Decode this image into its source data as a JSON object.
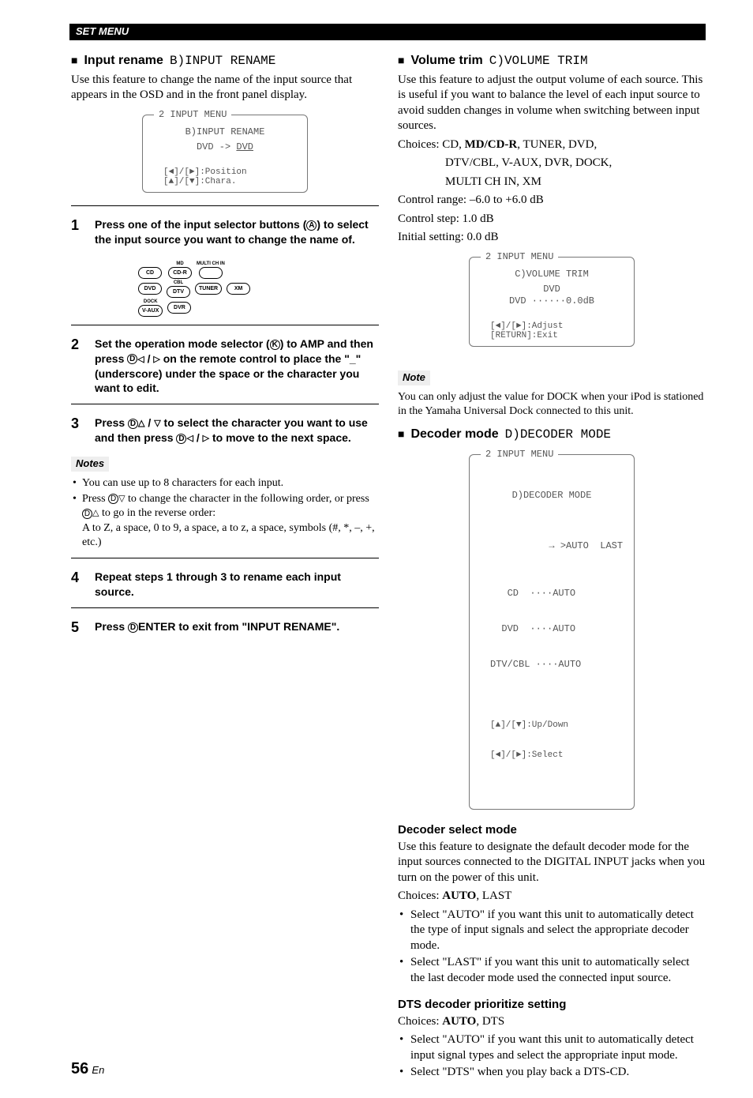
{
  "header": "SET MENU",
  "page_number": "56",
  "page_lang": "En",
  "left": {
    "sec1": {
      "square": "■",
      "title": "Input rename",
      "code": "B)INPUT RENAME",
      "desc": "Use this feature to change the name of the input source that appears in the OSD and in the front panel display.",
      "osd": {
        "tab": "2 INPUT MENU",
        "l1": "B)INPUT RENAME",
        "l2": "DVD -> ",
        "l2b": "DVD",
        "foot1": "[◄]/[►]:Position",
        "foot2": "[▲]/[▼]:Chara."
      }
    },
    "step1": {
      "num": "1",
      "text_a": "Press one of the input selector buttons (",
      "circ": "A",
      "text_b": ") to select the input source you want to change the name of."
    },
    "selector": {
      "row1": {
        "l1": "",
        "b1": "CD",
        "l2": "MD",
        "b2": "CD-R",
        "l3": "MULTI CH IN",
        "b3": ""
      },
      "row2": {
        "l1": "",
        "b1": "DVD",
        "l2": "CBL",
        "b2": "DTV",
        "b3": "TUNER",
        "b4": "XM"
      },
      "row3": {
        "l1": "DOCK",
        "b1": "V-AUX",
        "b2": "DVR"
      }
    },
    "step2": {
      "num": "2",
      "text_a": "Set the operation mode selector (",
      "circK": "K",
      "text_b": ") to ",
      "amp": "AMP",
      "text_c": " and then press ",
      "circD": "D",
      "text_d": " on the remote control to place the \"_\" (underscore) under the space or the character you want to edit.",
      "tri_l": "◁",
      "tri_r": "▷"
    },
    "step3": {
      "num": "3",
      "text_a": "Press ",
      "circD": "D",
      "tri_u": "△",
      "tri_d": "▽",
      "text_b": " to select the character you want to use and then press ",
      "text_c": " to move to the next space.",
      "tri_l": "◁",
      "tri_r": "▷"
    },
    "notes_label": "Notes",
    "notes": {
      "n1": "You can use up to 8 characters for each input.",
      "n2a": "Press ",
      "n2b": " to change the character in the following order, or press ",
      "n2c": " to go in the reverse order:",
      "n2d": "A to Z, a space, 0 to 9, a space, a to z, a space, symbols (#, *, –, +, etc.)",
      "circD": "D",
      "tri_d": "▽",
      "tri_u": "△"
    },
    "step4": {
      "num": "4",
      "text": "Repeat steps 1 through 3 to rename each input source."
    },
    "step5": {
      "num": "5",
      "text_a": "Press ",
      "circD": "D",
      "enter": "ENTER",
      "text_b": " to exit from \"INPUT RENAME\"."
    }
  },
  "right": {
    "sec_vol": {
      "square": "■",
      "title": "Volume trim",
      "code": "C)VOLUME TRIM",
      "desc": "Use this feature to adjust the output volume of each source. This is useful if you want to balance the level of each input source to avoid sudden changes in volume when switching between input sources.",
      "choices_label": "Choices: CD, ",
      "choices_bold": "MD/CD-R",
      "choices_rest": ", TUNER, DVD,",
      "choices_line2": "DTV/CBL, V-AUX, DVR, DOCK,",
      "choices_line3": "MULTI CH IN, XM",
      "range": "Control range: –6.0 to +6.0 dB",
      "step": "Control step: 1.0 dB",
      "init": "Initial setting: 0.0 dB",
      "osd": {
        "tab": "2 INPUT MENU",
        "l1": "C)VOLUME TRIM",
        "l2": "DVD",
        "l3": "DVD ······0.0dB",
        "foot1": "[◄]/[►]:Adjust",
        "foot2": "[RETURN]:Exit"
      }
    },
    "note_label": "Note",
    "note_text": "You can only adjust the value for DOCK when your iPod is stationed in the Yamaha Universal Dock connected to this unit.",
    "sec_dec": {
      "square": "■",
      "title": "Decoder mode",
      "code": "D)DECODER MODE",
      "osd": {
        "tab": "2 INPUT MENU",
        "l1": "D)DECODER MODE",
        "arrow": "→",
        "r1": ">AUTO  LAST",
        "r2": "   CD  ····AUTO",
        "r3": "  DVD  ····AUTO",
        "r4": "DTV/CBL ····AUTO",
        "foot1": "[▲]/[▼]:Up/Down",
        "foot2": "[◄]/[►]:Select"
      }
    },
    "dec_select": {
      "head": "Decoder select mode",
      "desc": "Use this feature to designate the default decoder mode for the input sources connected to the DIGITAL INPUT jacks when you turn on the power of this unit.",
      "choices_label": "Choices: ",
      "choices_bold": "AUTO",
      "choices_rest": ", LAST",
      "b1": "Select \"AUTO\" if you want this unit to automatically detect the type of input signals and select the appropriate decoder mode.",
      "b2": "Select \"LAST\" if you want this unit to automatically select the last decoder mode used the connected input source."
    },
    "dts": {
      "head": "DTS decoder prioritize setting",
      "choices_label": "Choices: ",
      "choices_bold": "AUTO",
      "choices_rest": ", DTS",
      "b1": "Select \"AUTO\" if you want this unit to automatically detect input signal types and select the appropriate input mode.",
      "b2": "Select \"DTS\" when you play back a DTS-CD."
    }
  }
}
